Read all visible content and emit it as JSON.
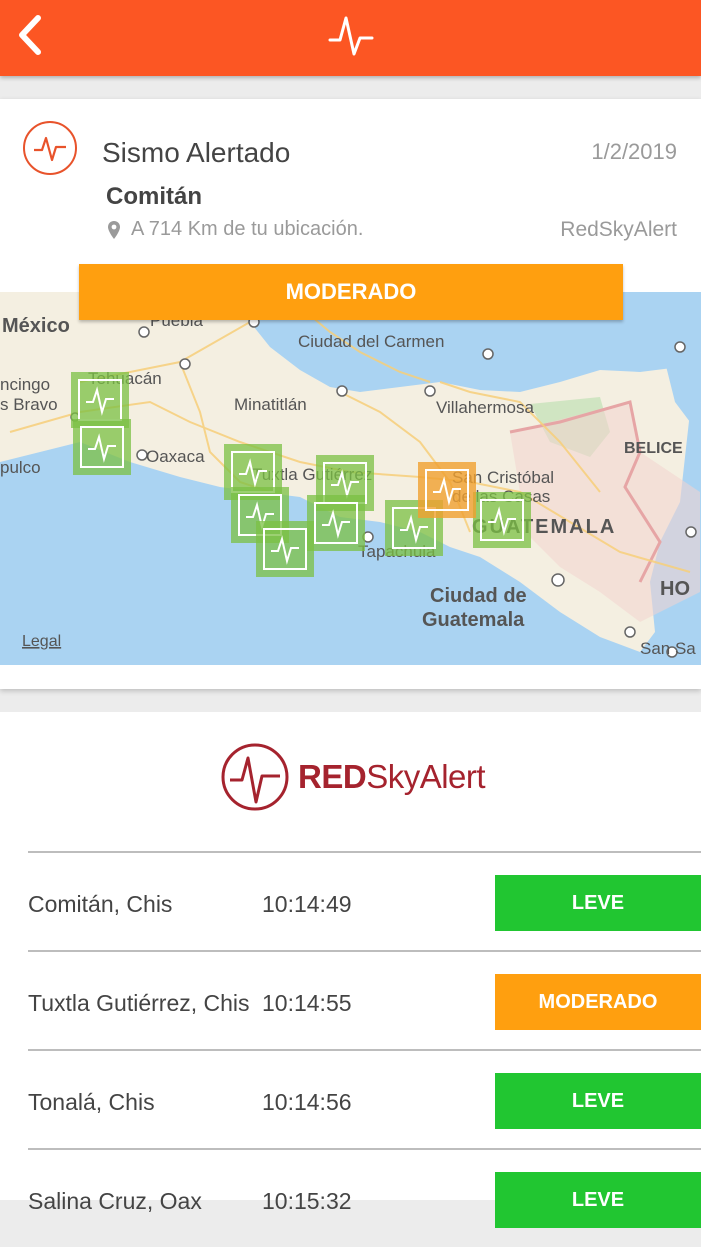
{
  "header": {
    "back_icon": "chevron-left-icon",
    "logo_icon": "seismograph-pulse-icon",
    "color": "#fc5623"
  },
  "alert": {
    "title": "Sismo Alertado",
    "date": "1/2/2019",
    "city": "Comitán",
    "distance": "A 714 Km de tu ubicación.",
    "source": "RedSkyAlert",
    "intensity": "MODERADO",
    "intensity_color": "#ff9f0f"
  },
  "map": {
    "labels": {
      "mexico": "México",
      "puebla": "Puebla",
      "ciudad_carmen": "Ciudad del Carmen",
      "tehuacan": "Tehuacán",
      "chilpancingo": "ncingo",
      "bravo": "s Bravo",
      "minatitlan": "Minatitlán",
      "villahermosa": "Villahermosa",
      "belice": "BELICE",
      "acapulco": "pulco",
      "oaxaca": "Oaxaca",
      "tuxtla": "Tuxtla Gutiérrez",
      "san_cristobal_1": "San Cristóbal",
      "san_cristobal_2": "de las Casas",
      "guatemala": "GUATEMALA",
      "tapachula": "Tapachula",
      "ciudad_guatemala_1": "Ciudad de",
      "ciudad_guatemala_2": "Guatemala",
      "honduras": "HO",
      "san_sa": "San Sa",
      "legal": "Legal"
    },
    "marker_colors": {
      "leve": "#7bc043",
      "moderado": "#f0a030"
    }
  },
  "brand": {
    "red": "RED",
    "sky": "SkyAlert"
  },
  "reports": [
    {
      "place": "Comitán, Chis",
      "time": "10:14:49",
      "level": "LEVE",
      "color": "#21c631"
    },
    {
      "place": "Tuxtla Gutiérrez, Chis",
      "time": "10:14:55",
      "level": "MODERADO",
      "color": "#ff9f0f"
    },
    {
      "place": "Tonalá, Chis",
      "time": "10:14:56",
      "level": "LEVE",
      "color": "#21c631"
    },
    {
      "place": "Salina Cruz, Oax",
      "time": "10:15:32",
      "level": "LEVE",
      "color": "#21c631"
    }
  ]
}
